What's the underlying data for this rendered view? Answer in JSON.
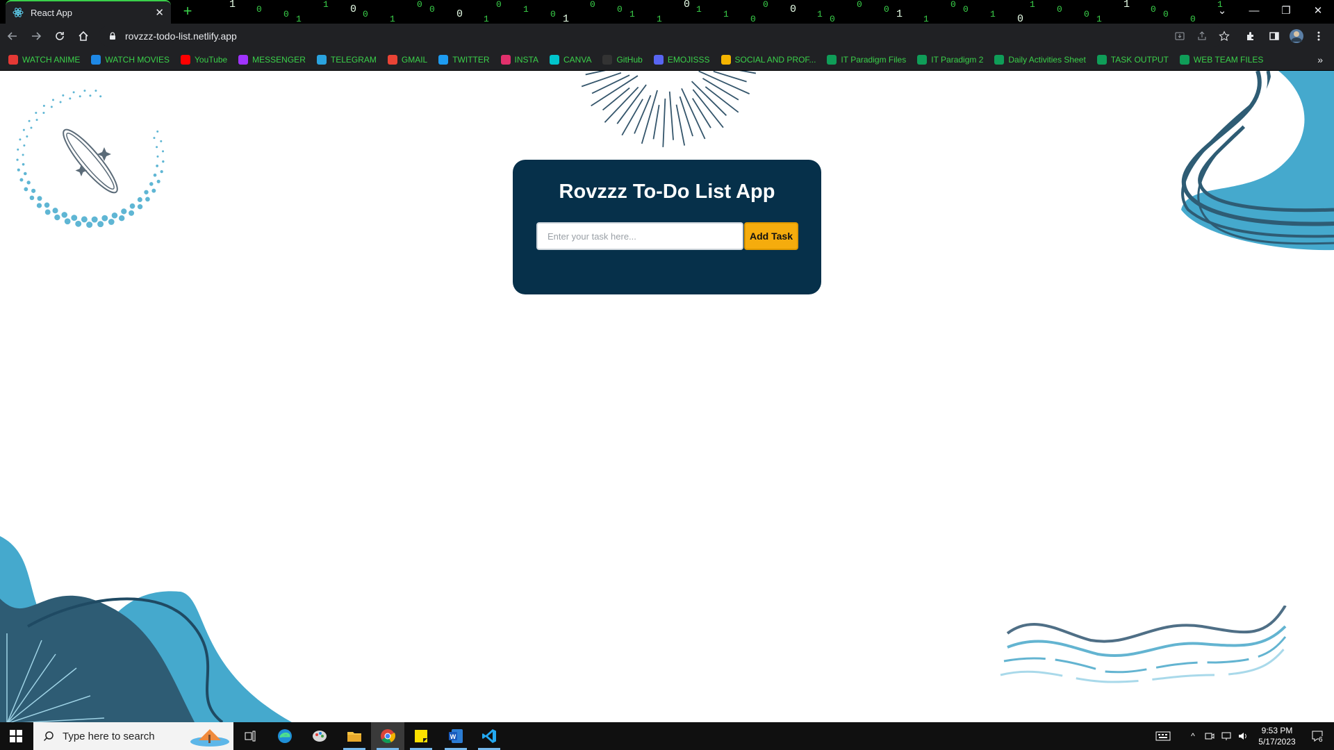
{
  "browser": {
    "tab": {
      "title": "React App"
    },
    "url": "rovzzz-todo-list.netlify.app",
    "matrix_digits": [
      "1",
      "0",
      "0",
      "1",
      "1",
      "0",
      "0",
      "1",
      "0",
      "0",
      "0",
      "1",
      "0",
      "1",
      "0",
      "1",
      "0",
      "0",
      "1",
      "1",
      "0",
      "1",
      "1",
      "0",
      "0",
      "0",
      "1",
      "0",
      "0",
      "0",
      "1",
      "1",
      "0",
      "0",
      "1",
      "0",
      "1",
      "0",
      "0",
      "1",
      "1",
      "0",
      "0",
      "0",
      "1"
    ],
    "bookmarks": [
      {
        "label": "WATCH ANIME",
        "icon": "anime-icon",
        "color": "#e53935"
      },
      {
        "label": "WATCH MOVIES",
        "icon": "movies-icon",
        "color": "#1e88e5"
      },
      {
        "label": "YouTube",
        "icon": "youtube-icon",
        "color": "#ff0000"
      },
      {
        "label": "MESSENGER",
        "icon": "messenger-icon",
        "color": "#a033ff"
      },
      {
        "label": "TELEGRAM",
        "icon": "telegram-icon",
        "color": "#2aa3df"
      },
      {
        "label": "GMAIL",
        "icon": "gmail-icon",
        "color": "#ea4335"
      },
      {
        "label": "TWITTER",
        "icon": "twitter-icon",
        "color": "#1d9bf0"
      },
      {
        "label": "INSTA",
        "icon": "instagram-icon",
        "color": "#e1306c"
      },
      {
        "label": "CANVA",
        "icon": "canva-icon",
        "color": "#00c4cc"
      },
      {
        "label": "GitHub",
        "icon": "github-icon",
        "color": "#333333"
      },
      {
        "label": "EMOJISSS",
        "icon": "emoji-icon",
        "color": "#5865f2"
      },
      {
        "label": "SOCIAL AND PROF...",
        "icon": "folder-icon",
        "color": "#f4b400"
      },
      {
        "label": "IT Paradigm Files",
        "icon": "drive-icon",
        "color": "#0f9d58"
      },
      {
        "label": "IT Paradigm 2",
        "icon": "drive-icon",
        "color": "#0f9d58"
      },
      {
        "label": "Daily Activities Sheet",
        "icon": "sheets-icon",
        "color": "#0f9d58"
      },
      {
        "label": "TASK OUTPUT",
        "icon": "drive-icon",
        "color": "#0f9d58"
      },
      {
        "label": "WEB TEAM FILES",
        "icon": "drive-icon",
        "color": "#0f9d58"
      }
    ],
    "accent": "#3ad14a"
  },
  "app": {
    "title": "Rovzzz To-Do List App",
    "input_placeholder": "Enter your task here...",
    "add_button": "Add Task",
    "card_color": "#06304a",
    "button_color": "#f5ac0d"
  },
  "taskbar": {
    "search_placeholder": "Type here to search",
    "time": "9:53 PM",
    "date": "5/17/2023",
    "notifications": "6"
  }
}
